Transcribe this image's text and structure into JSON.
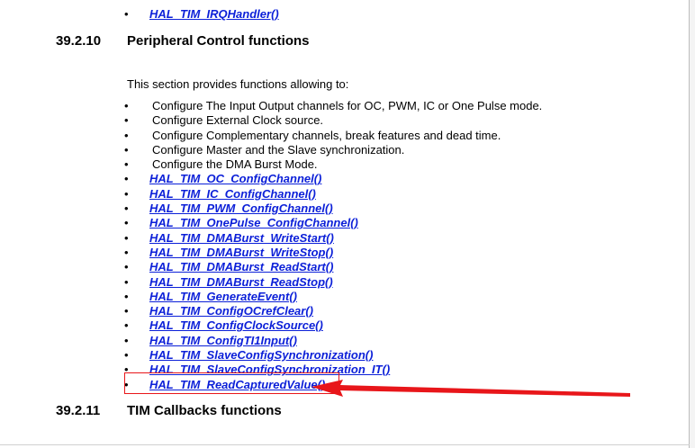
{
  "top_item": {
    "bullet": "•",
    "label": "HAL_TIM_IRQHandler()"
  },
  "section": {
    "number": "39.2.10",
    "title": "Peripheral Control functions",
    "intro": "This section provides functions allowing to:",
    "bullets": [
      "Configure The Input Output channels for OC, PWM, IC or One Pulse mode.",
      "Configure External Clock source.",
      "Configure Complementary channels, break features and dead time.",
      "Configure Master and the Slave synchronization.",
      "Configure the DMA Burst Mode."
    ],
    "functions": [
      "HAL_TIM_OC_ConfigChannel()",
      "HAL_TIM_IC_ConfigChannel()",
      "HAL_TIM_PWM_ConfigChannel()",
      "HAL_TIM_OnePulse_ConfigChannel()",
      "HAL_TIM_DMABurst_WriteStart()",
      "HAL_TIM_DMABurst_WriteStop()",
      "HAL_TIM_DMABurst_ReadStart()",
      "HAL_TIM_DMABurst_ReadStop()",
      "HAL_TIM_GenerateEvent()",
      "HAL_TIM_ConfigOCrefClear()",
      "HAL_TIM_ConfigClockSource()",
      "HAL_TIM_ConfigTI1Input()",
      "HAL_TIM_SlaveConfigSynchronization()",
      "HAL_TIM_SlaveConfigSynchronization_IT()",
      "HAL_TIM_ReadCapturedValue()"
    ],
    "bullet_char": "•"
  },
  "next_section": {
    "number": "39.2.11",
    "title": "TIM Callbacks functions"
  },
  "annotation": {
    "highlighted_item": "HAL_TIM_ReadCapturedValue()",
    "color": "#e8161a"
  },
  "colors": {
    "link": "#0b1fd8"
  }
}
